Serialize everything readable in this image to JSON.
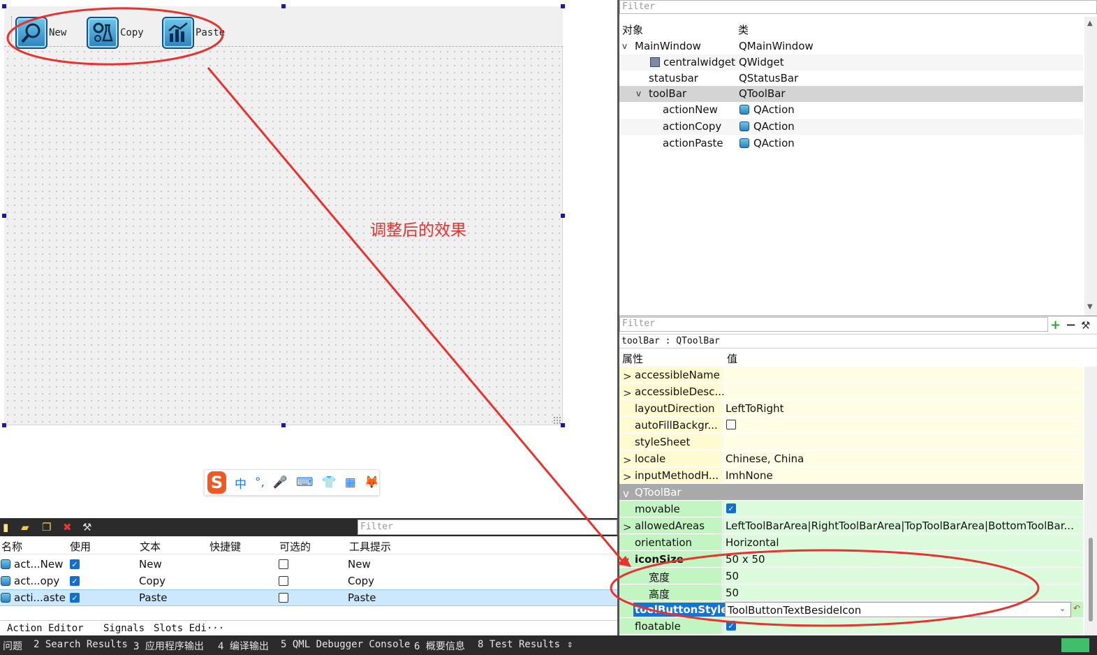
{
  "designer": {
    "toolbar_actions": [
      {
        "label": "New",
        "icon": "search-globe-icon"
      },
      {
        "label": "Copy",
        "icon": "gear-flask-icon"
      },
      {
        "label": "Paste",
        "icon": "bar-chart-icon"
      }
    ],
    "annotation": "调整后的效果"
  },
  "ime_bar": {
    "logo": "S",
    "items": [
      "中",
      "°,",
      "🎤",
      "⌨",
      "👕",
      "▦",
      "🦊"
    ]
  },
  "action_editor": {
    "toolbar_icons": [
      "new-file-icon",
      "open-folder-icon",
      "copy-icon",
      "delete-icon",
      "wrench-icon"
    ],
    "filter_placeholder": "Filter",
    "columns": [
      "名称",
      "使用",
      "文本",
      "快捷键",
      "可选的",
      "工具提示"
    ],
    "rows": [
      {
        "name": "act...New",
        "used": true,
        "text": "New",
        "shortcut": "",
        "checkable": false,
        "tooltip": "New",
        "selected": false
      },
      {
        "name": "act...opy",
        "used": true,
        "text": "Copy",
        "shortcut": "",
        "checkable": false,
        "tooltip": "Copy",
        "selected": false
      },
      {
        "name": "acti...aste",
        "used": true,
        "text": "Paste",
        "shortcut": "",
        "checkable": false,
        "tooltip": "Paste",
        "selected": true
      }
    ],
    "tabs": [
      "Action Editor",
      "Signals",
      "Slots Edi···"
    ]
  },
  "bottom_bar": {
    "items": [
      "问题",
      "2 Search Results",
      "3 应用程序输出",
      "4 编译输出",
      "5 QML Debugger Console",
      "6 概要信息",
      "8 Test Results",
      "⇕"
    ]
  },
  "object_inspector": {
    "filter_placeholder": "Filter",
    "col_object": "对象",
    "col_class": "类",
    "rows": [
      {
        "name": "MainWindow",
        "class": "QMainWindow",
        "expand": "v"
      },
      {
        "name": "centralwidget",
        "class": "QWidget",
        "expand": ""
      },
      {
        "name": "statusbar",
        "class": "QStatusBar",
        "expand": ""
      },
      {
        "name": "toolBar",
        "class": "QToolBar",
        "expand": "v"
      },
      {
        "name": "actionNew",
        "class": "QAction",
        "expand": ""
      },
      {
        "name": "actionCopy",
        "class": "QAction",
        "expand": ""
      },
      {
        "name": "actionPaste",
        "class": "QAction",
        "expand": ""
      }
    ]
  },
  "property_editor": {
    "filter_placeholder": "Filter",
    "add_label": "+",
    "remove_label": "−",
    "object_label": "toolBar : QToolBar",
    "col_property": "属性",
    "col_value": "值",
    "rows": [
      {
        "name": "accessibleName",
        "value": "",
        "expand": ">"
      },
      {
        "name": "accessibleDesc...",
        "value": "",
        "expand": ">"
      },
      {
        "name": "layoutDirection",
        "value": "LeftToRight",
        "expand": ""
      },
      {
        "name": "autoFillBackgr...",
        "value": "",
        "expand": ""
      },
      {
        "name": "styleSheet",
        "value": "",
        "expand": ""
      },
      {
        "name": "locale",
        "value": "Chinese, China",
        "expand": ">"
      },
      {
        "name": "inputMethodH...",
        "value": "ImhNone",
        "expand": ">"
      },
      {
        "name": "QToolBar",
        "value": "",
        "expand": "v"
      },
      {
        "name": "movable",
        "value": "",
        "expand": ""
      },
      {
        "name": "allowedAreas",
        "value": "LeftToolBarArea|RightToolBarArea|TopToolBarArea|BottomToolBar...",
        "expand": ">"
      },
      {
        "name": "orientation",
        "value": "Horizontal",
        "expand": ""
      },
      {
        "name": "iconSize",
        "value": "50 x 50",
        "expand": "v"
      },
      {
        "name": "宽度",
        "value": "50",
        "expand": ""
      },
      {
        "name": "高度",
        "value": "50",
        "expand": ""
      },
      {
        "name": "toolButtonStyle",
        "value": "ToolButtonTextBesideIcon",
        "expand": ""
      },
      {
        "name": "floatable",
        "value": "",
        "expand": ""
      }
    ]
  },
  "colors": {
    "annotation_red": "#e8322e",
    "selection_blue": "#1673d6",
    "prop_yellow": "#fffbd0",
    "prop_green": "#c3f5c3"
  }
}
